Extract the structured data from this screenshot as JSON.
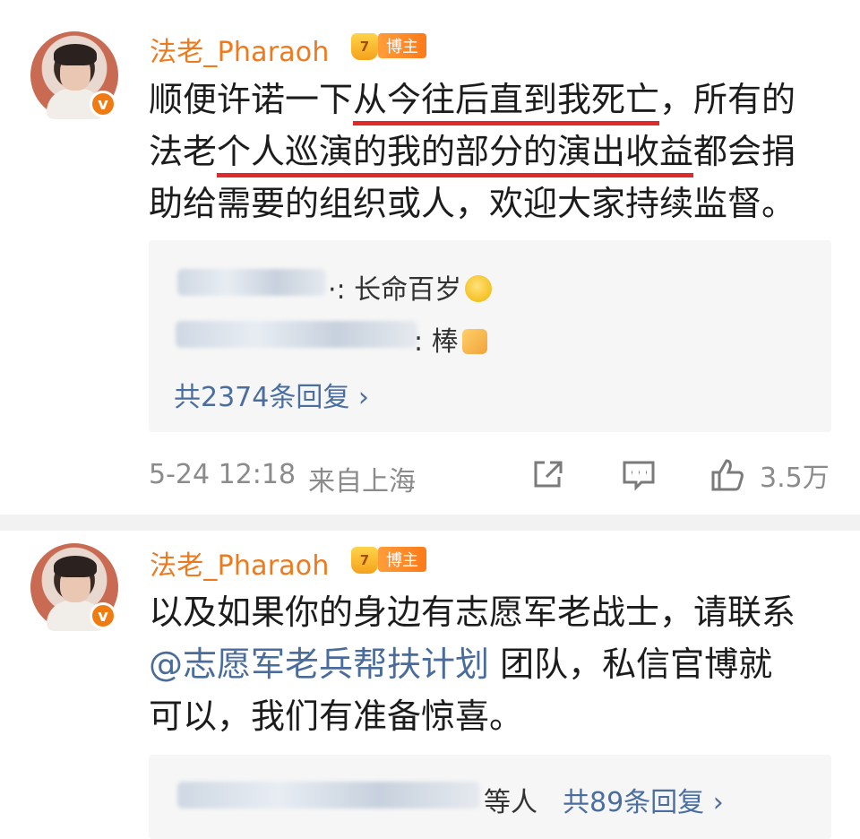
{
  "posts": [
    {
      "username": "法老_Pharaoh",
      "verified_icon": "v",
      "level_icon": "7",
      "badge": "博主",
      "content": {
        "line1_pre": "顺便许诺一下",
        "line1_ul": "从今往后直到我死亡",
        "line1_post": "，所有的",
        "line2_pre": "法老",
        "line2_ul": "个人巡演的我的部分的演出收益",
        "line2_post": "都会捐",
        "line3": "助给需要的组织或人，欢迎大家持续监督。"
      },
      "replies": [
        {
          "suffix": "·: 长命百岁",
          "emoji": "smiling-face-emoji"
        },
        {
          "suffix": ": 棒",
          "emoji": "thumbs-up-emoji"
        }
      ],
      "more_replies": "共2374条回复 ›",
      "timestamp": "5-24 12:18",
      "location": "来自上海",
      "like_count": "3.5万"
    },
    {
      "username": "法老_Pharaoh",
      "verified_icon": "v",
      "level_icon": "7",
      "badge": "博主",
      "content": {
        "line1": "以及如果你的身边有志愿军老战士，请联系",
        "mention": "@志愿军老兵帮扶计划",
        "line2_post": " 团队，私信官博就",
        "line3": "可以，我们有准备惊喜。"
      },
      "replies_suffix": "等人",
      "more_replies": "共89条回复 ›"
    }
  ],
  "colors": {
    "username": "#ee7a1e",
    "underline": "#e02a2a",
    "link": "#4b6ea0",
    "meta": "#8b8b8b"
  }
}
